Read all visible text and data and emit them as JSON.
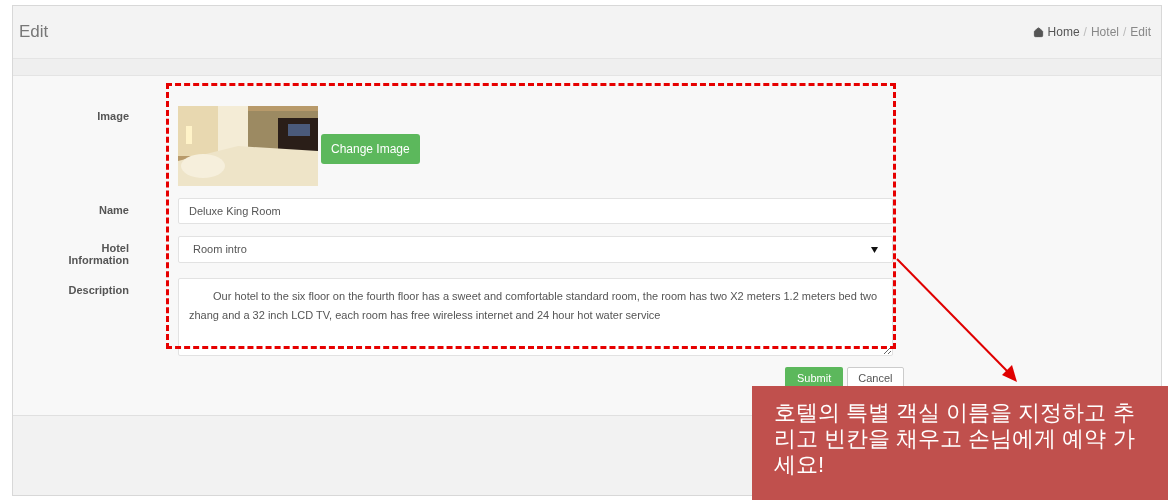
{
  "header": {
    "title": "Edit",
    "breadcrumb": {
      "separator": "/",
      "items": [
        {
          "label": "Home"
        },
        {
          "label": "Hotel"
        },
        {
          "label": "Edit"
        }
      ]
    }
  },
  "form": {
    "fields": [
      {
        "label": "Image",
        "button": "Change Image"
      },
      {
        "kind": "text",
        "label": "Name",
        "value": "Deluxe King Room"
      },
      {
        "kind": "select",
        "label": "Hotel Information",
        "value": "Room intro"
      },
      {
        "kind": "textarea",
        "label": "Description",
        "value": "Our hotel to the six floor on the fourth floor has a sweet and comfortable standard room, the room has two X2 meters 1.2 meters bed two zhang and a 32 inch LCD TV, each room has free wireless internet and 24 hour hot water service"
      }
    ],
    "buttons": [
      {
        "label": "Submit",
        "kind": "primary"
      },
      {
        "label": "Cancel",
        "kind": "default"
      }
    ]
  },
  "callout": {
    "lines": [
      "호텔의 특별 객실 이름을 지정하고 추",
      "리고 빈칸을 채우고 손님에게 예약 가",
      "세요!"
    ]
  }
}
